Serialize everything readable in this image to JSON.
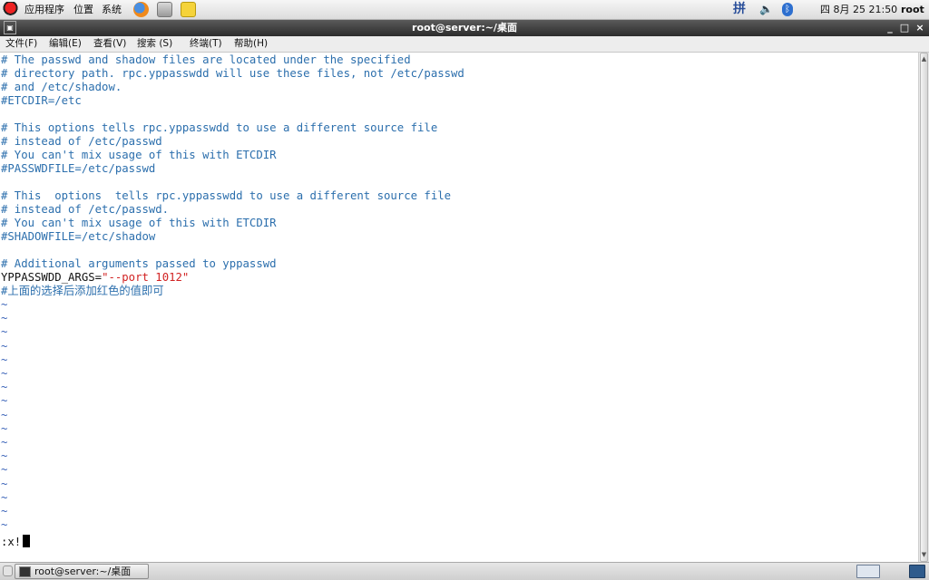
{
  "top_panel": {
    "applications_label": "应用程序",
    "places_label": "位置",
    "system_label": "系统",
    "input_method_label": "拼",
    "clock": "四 8月 25 21:50",
    "user": "root"
  },
  "window": {
    "title": "root@server:~/桌面"
  },
  "menubar": {
    "items": [
      "文件(F)",
      "编辑(E)",
      "查看(V)",
      "搜索 (S)",
      "终端(T)",
      "帮助(H)"
    ]
  },
  "terminal": {
    "lines": [
      "# The passwd and shadow files are located under the specified",
      "# directory path. rpc.yppasswdd will use these files, not /etc/passwd",
      "# and /etc/shadow.",
      "#ETCDIR=/etc",
      "",
      "# This options tells rpc.yppasswdd to use a different source file",
      "# instead of /etc/passwd",
      "# You can't mix usage of this with ETCDIR",
      "#PASSWDFILE=/etc/passwd",
      "",
      "# This  options  tells rpc.yppasswdd to use a different source file",
      "# instead of /etc/passwd.",
      "# You can't mix usage of this with ETCDIR",
      "#SHADOWFILE=/etc/shadow",
      "",
      "# Additional arguments passed to yppasswd"
    ],
    "args_key": "YPPASSWDD_ARGS=",
    "args_value": "\"--port 1012\"",
    "chinese_comment": "#上面的选择后添加红色的值即可",
    "tilde": "~",
    "tilde_count": 17,
    "command_line": ":x!"
  },
  "taskbar": {
    "task_label": "root@server:~/桌面"
  },
  "colors": {
    "comment": "#2c6fad",
    "highlight_value": "#d12222",
    "tilde": "#3a63b8",
    "titlebar": "#3a3a3a"
  }
}
